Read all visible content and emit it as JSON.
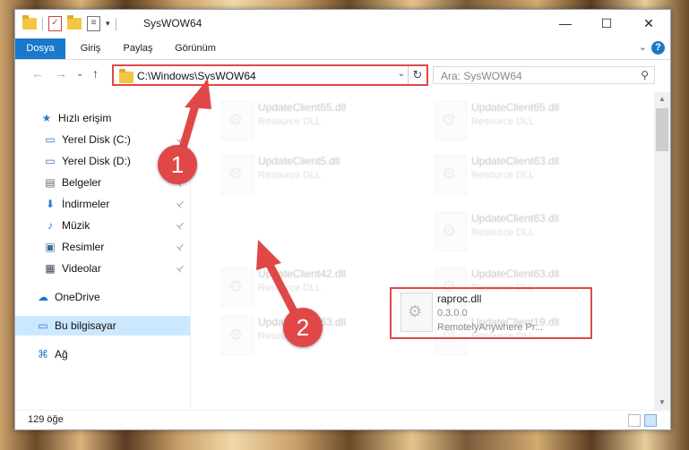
{
  "window": {
    "title": "SysWOW64",
    "minimize_glyph": "—",
    "maximize_glyph": "☐",
    "close_glyph": "✕"
  },
  "ribbon": {
    "tabs": [
      "Dosya",
      "Giriş",
      "Paylaş",
      "Görünüm"
    ],
    "help_glyph": "?",
    "collapse_glyph": "⌄"
  },
  "navbar": {
    "back_glyph": "←",
    "forward_glyph": "→",
    "recent_glyph": "⌄",
    "up_glyph": "↑",
    "address": "C:\\Windows\\SysWOW64",
    "address_dropdown_glyph": "⌄",
    "refresh_glyph": "↻",
    "search_placeholder": "Ara: SysWOW64",
    "search_glyph": "⚲"
  },
  "sidebar": {
    "items": [
      {
        "label": "Hızlı erişim",
        "icon": "star-icon",
        "glyph": "★",
        "color": "#2b7cd3",
        "pinned": false
      },
      {
        "label": "Yerel Disk (C:)",
        "icon": "drive-icon",
        "glyph": "▭",
        "color": "#3a6ea5",
        "pinned": true
      },
      {
        "label": "Yerel Disk (D:)",
        "icon": "drive-icon",
        "glyph": "▭",
        "color": "#3a6ea5",
        "pinned": true
      },
      {
        "label": "Belgeler",
        "icon": "document-icon",
        "glyph": "▤",
        "color": "#5a6a7a",
        "pinned": true
      },
      {
        "label": "İndirmeler",
        "icon": "download-icon",
        "glyph": "⬇",
        "color": "#2b7cd3",
        "pinned": true
      },
      {
        "label": "Müzik",
        "icon": "music-icon",
        "glyph": "♪",
        "color": "#2b7cd3",
        "pinned": true
      },
      {
        "label": "Resimler",
        "icon": "pictures-icon",
        "glyph": "▣",
        "color": "#3a6ea5",
        "pinned": true
      },
      {
        "label": "Videolar",
        "icon": "video-icon",
        "glyph": "▦",
        "color": "#3a4a5a",
        "pinned": true
      },
      {
        "label": "OneDrive",
        "icon": "cloud-icon",
        "glyph": "☁",
        "color": "#1f74c8",
        "pinned": false
      },
      {
        "label": "Bu bilgisayar",
        "icon": "computer-icon",
        "glyph": "▭",
        "color": "#2b7cd3",
        "pinned": false,
        "selected": true
      },
      {
        "label": "Ağ",
        "icon": "network-icon",
        "glyph": "⌘",
        "color": "#2b7cd3",
        "pinned": false
      }
    ],
    "pin_glyph": "📌"
  },
  "files": [
    {
      "name": "UpdateClient65.dll",
      "type": "Resource DLL"
    },
    {
      "name": "UpdateClient65.dll",
      "type": "Resource DLL"
    },
    {
      "name": "UpdateClient5.dll",
      "type": "Resource DLL"
    },
    {
      "name": "UpdateClient63.dll",
      "type": "Resource DLL"
    },
    {
      "name": "UpdateClient63.dll",
      "type": "Resource DLL"
    },
    {
      "name": "UpdateClient42.dll",
      "type": "Resource DLL"
    },
    {
      "name": "UpdateClient63.dll",
      "type": "Resource DLL"
    },
    {
      "name": "UpdateClient63.dll",
      "type": "Resource DLL"
    },
    {
      "name": "UpdateClient19.dll",
      "type": "Resource DLL"
    }
  ],
  "highlighted_file": {
    "name": "raproc.dll",
    "version": "0.3.0.0",
    "company": "RemotelyAnywhere Pr..."
  },
  "scrollbar": {
    "up_glyph": "▲",
    "down_glyph": "▼"
  },
  "status": {
    "count": "129 öğe"
  },
  "annotations": {
    "badge_1": "1",
    "badge_2": "2",
    "accent": "#e04848"
  }
}
